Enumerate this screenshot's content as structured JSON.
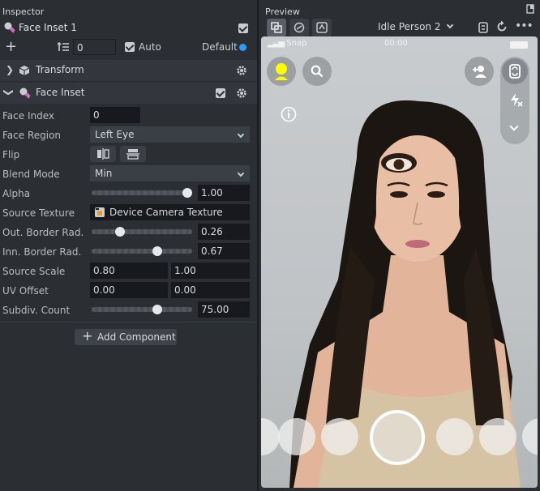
{
  "inspector": {
    "title": "Inspector",
    "object_name": "Face Inset 1",
    "layer_value": "0",
    "auto_label": "Auto",
    "default_label": "Default",
    "sections": {
      "transform": "Transform",
      "face_inset": "Face Inset"
    },
    "properties": {
      "face_index_label": "Face Index",
      "face_index_value": "0",
      "face_region_label": "Face Region",
      "face_region_value": "Left Eye",
      "flip_label": "Flip",
      "blend_mode_label": "Blend Mode",
      "blend_mode_value": "Min",
      "alpha_label": "Alpha",
      "alpha_value": "1.00",
      "source_texture_label": "Source Texture",
      "source_texture_value": "Device Camera Texture",
      "outer_border_label": "Out. Border Rad.",
      "outer_border_value": "0.26",
      "inner_border_label": "Inn. Border Rad.",
      "inner_border_value": "0.67",
      "source_scale_label": "Source Scale",
      "source_scale_x": "0.80",
      "source_scale_y": "1.00",
      "uv_offset_label": "UV Offset",
      "uv_offset_x": "0.00",
      "uv_offset_y": "0.00",
      "subdiv_label": "Subdiv. Count",
      "subdiv_value": "75.00"
    },
    "add_component_label": "Add Component"
  },
  "preview": {
    "title": "Preview",
    "preset": "Idle Person 2",
    "status_carrier": "Snap",
    "status_time": "00:00"
  },
  "colors": {
    "accent_blue": "#2d9cff",
    "snap_yellow": "#fffc00"
  }
}
